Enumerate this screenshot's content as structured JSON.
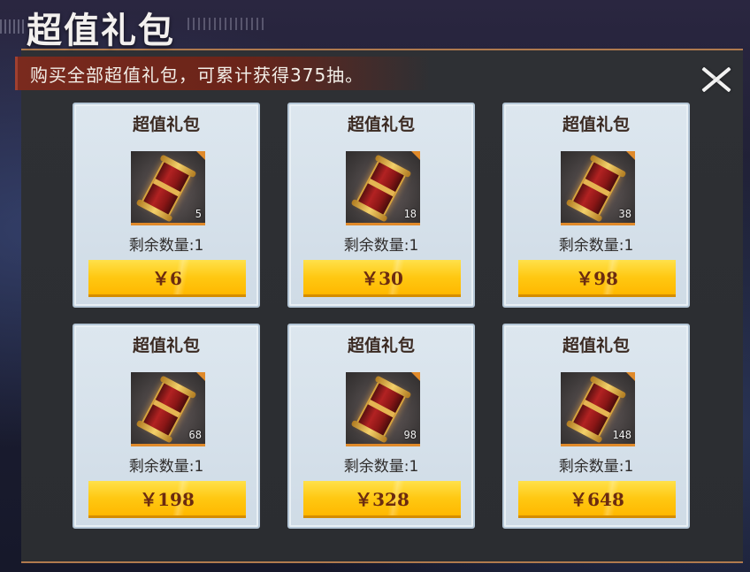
{
  "header": {
    "title": "超值礼包"
  },
  "banner": {
    "text": "购买全部超值礼包，可累计获得375抽。"
  },
  "cards": [
    {
      "title": "超值礼包",
      "quantity": "5",
      "remaining": "剩余数量:1",
      "price": "￥6"
    },
    {
      "title": "超值礼包",
      "quantity": "18",
      "remaining": "剩余数量:1",
      "price": "￥30"
    },
    {
      "title": "超值礼包",
      "quantity": "38",
      "remaining": "剩余数量:1",
      "price": "￥98"
    },
    {
      "title": "超值礼包",
      "quantity": "68",
      "remaining": "剩余数量:1",
      "price": "￥198"
    },
    {
      "title": "超值礼包",
      "quantity": "98",
      "remaining": "剩余数量:1",
      "price": "￥328"
    },
    {
      "title": "超值礼包",
      "quantity": "148",
      "remaining": "剩余数量:1",
      "price": "￥648"
    }
  ],
  "icons": {
    "close": "close-icon",
    "item": "scroll-icon"
  },
  "colors": {
    "accent": "#ffc812",
    "banner": "#7a2a1e",
    "card": "#dde7ef",
    "panel_border": "#b07a4e"
  }
}
